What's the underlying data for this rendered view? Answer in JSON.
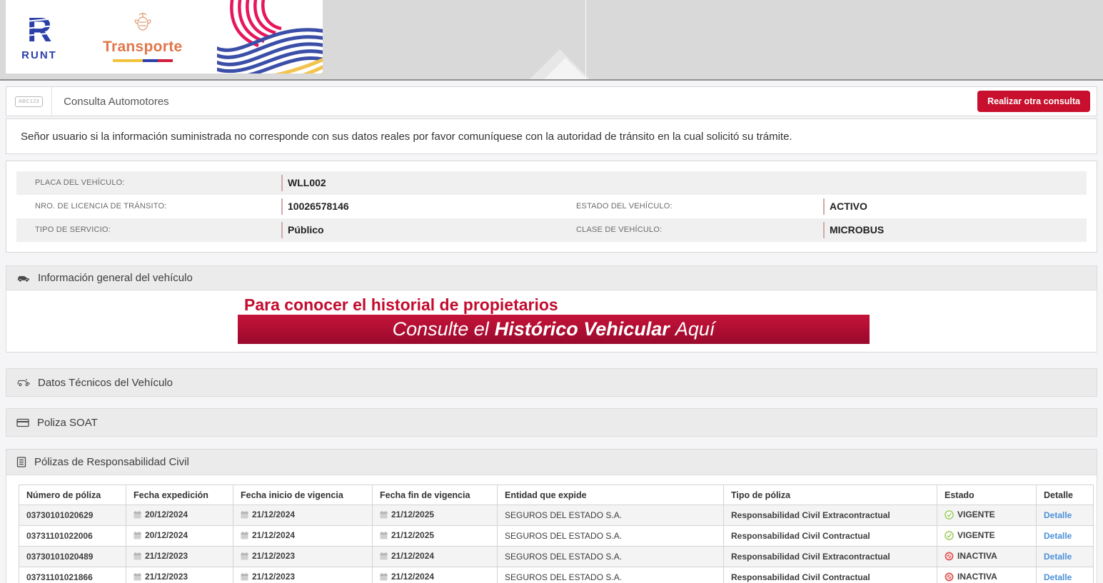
{
  "brand": {
    "runt_label": "RUNT",
    "transporte_label": "Transporte"
  },
  "toolbar": {
    "plate_badge": "ABC123",
    "title": "Consulta Automotores",
    "action_button": "Realizar otra consulta"
  },
  "notice": {
    "text": "Señor usuario si la información suministrada no corresponde con sus datos reales por favor comuníquese con la autoridad de tránsito en la cual solicitó su trámite."
  },
  "vehicle_summary": {
    "plate": {
      "label": "PLACA DEL VEHÍCULO:",
      "value": "WLL002"
    },
    "license": {
      "label": "NRO. DE LICENCIA DE TRÁNSITO:",
      "value": "10026578146"
    },
    "state": {
      "label": "ESTADO DEL VEHÍCULO:",
      "value": "ACTIVO"
    },
    "service": {
      "label": "TIPO DE SERVICIO:",
      "value": "Público"
    },
    "vehicle_class": {
      "label": "CLASE DE VEHÍCULO:",
      "value": "MICROBUS"
    }
  },
  "sections": {
    "general": "Información general del vehículo",
    "technical": "Datos Técnicos del Vehículo",
    "soat": "Poliza SOAT",
    "liability": "Pólizas de Responsabilidad Civil"
  },
  "banner": {
    "headline": "Para conocer el historial de propietarios",
    "cta_prefix": "Consulte el",
    "cta_bold": "Histórico Vehicular",
    "cta_suffix": "Aquí"
  },
  "policies": {
    "columns": [
      "Número de póliza",
      "Fecha expedición",
      "Fecha inicio de vigencia",
      "Fecha fin de vigencia",
      "Entidad que expide",
      "Tipo de póliza",
      "Estado",
      "Detalle"
    ],
    "rows": [
      {
        "number": "03730101020629",
        "issued": "20/12/2024",
        "start": "21/12/2024",
        "end": "21/12/2025",
        "entity": "SEGUROS DEL ESTADO S.A.",
        "type": "Responsabilidad Civil Extracontractual",
        "status": "VIGENTE",
        "status_state": "vigente",
        "detail": "Detalle"
      },
      {
        "number": "03731101022006",
        "issued": "20/12/2024",
        "start": "21/12/2024",
        "end": "21/12/2025",
        "entity": "SEGUROS DEL ESTADO S.A.",
        "type": "Responsabilidad Civil Contractual",
        "status": "VIGENTE",
        "status_state": "vigente",
        "detail": "Detalle"
      },
      {
        "number": "03730101020489",
        "issued": "21/12/2023",
        "start": "21/12/2023",
        "end": "21/12/2024",
        "entity": "SEGUROS DEL ESTADO S.A.",
        "type": "Responsabilidad Civil Extracontractual",
        "status": "INACTIVA",
        "status_state": "inactiva",
        "detail": "Detalle"
      },
      {
        "number": "03731101021866",
        "issued": "21/12/2023",
        "start": "21/12/2023",
        "end": "21/12/2024",
        "entity": "SEGUROS DEL ESTADO S.A.",
        "type": "Responsabilidad Civil Contractual",
        "status": "INACTIVA",
        "status_state": "inactiva",
        "detail": "Detalle"
      }
    ]
  },
  "colors": {
    "accent_red": "#c8102e",
    "banner_red_top": "#c51339",
    "banner_red_bottom": "#99092c",
    "link_blue": "#4a90d9",
    "status_active_green": "#9dcc5f",
    "status_inactive_red": "#e05c5c",
    "runt_blue": "#2b3fa8",
    "transporte_orange": "#e0764a"
  }
}
